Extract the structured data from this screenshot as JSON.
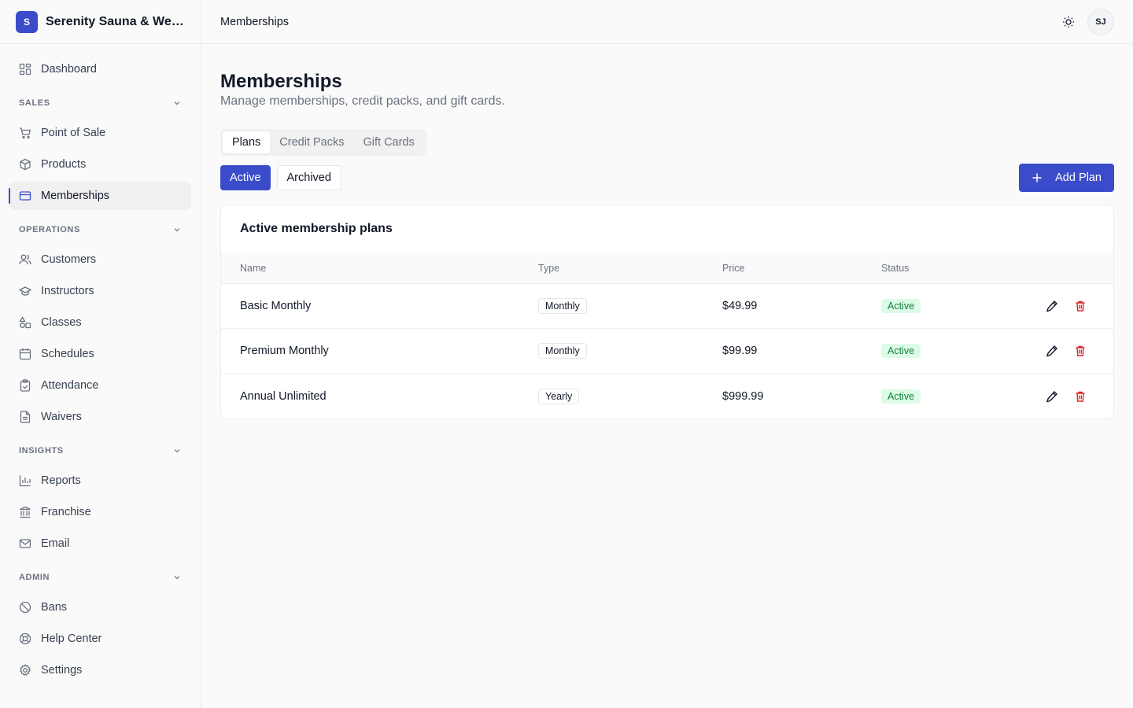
{
  "brand": {
    "logo_letter": "S",
    "name": "Serenity Sauna & Wellness"
  },
  "nav": {
    "dashboard": "Dashboard",
    "sections": {
      "sales": "SALES",
      "operations": "OPERATIONS",
      "insights": "INSIGHTS",
      "admin": "ADMIN"
    },
    "items": {
      "pos": "Point of Sale",
      "products": "Products",
      "memberships": "Memberships",
      "customers": "Customers",
      "instructors": "Instructors",
      "classes": "Classes",
      "schedules": "Schedules",
      "attendance": "Attendance",
      "waivers": "Waivers",
      "reports": "Reports",
      "franchise": "Franchise",
      "email": "Email",
      "bans": "Bans",
      "help": "Help Center",
      "settings": "Settings"
    }
  },
  "topbar": {
    "breadcrumb": "Memberships",
    "avatar_initials": "SJ"
  },
  "page": {
    "title": "Memberships",
    "subtitle": "Manage memberships, credit packs, and gift cards."
  },
  "tabs": {
    "plans": "Plans",
    "credit_packs": "Credit Packs",
    "gift_cards": "Gift Cards"
  },
  "filters": {
    "active": "Active",
    "archived": "Archived"
  },
  "add_button": "Add Plan",
  "table": {
    "title": "Active membership plans",
    "headers": {
      "name": "Name",
      "type": "Type",
      "price": "Price",
      "status": "Status"
    },
    "rows": [
      {
        "name": "Basic Monthly",
        "type": "Monthly",
        "price": "$49.99",
        "status": "Active"
      },
      {
        "name": "Premium Monthly",
        "type": "Monthly",
        "price": "$99.99",
        "status": "Active"
      },
      {
        "name": "Annual Unlimited",
        "type": "Yearly",
        "price": "$999.99",
        "status": "Active"
      }
    ]
  },
  "colors": {
    "accent": "#3b4cca",
    "danger": "#dc2626",
    "success_bg": "#dcfce7",
    "success_text": "#15803d"
  }
}
